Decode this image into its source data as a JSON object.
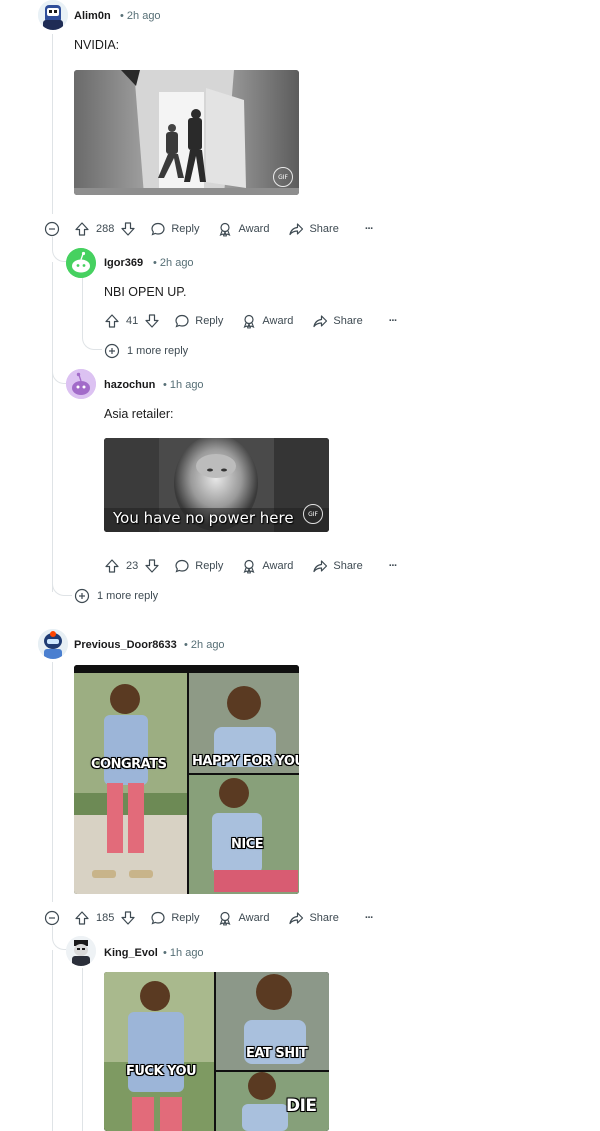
{
  "comments": [
    {
      "user": "Alim0n",
      "time": "• 2h ago",
      "text": "NVIDIA:",
      "media": {
        "type": "gif",
        "badge": "GIF"
      },
      "actions": {
        "upvotes": "288",
        "reply": "Reply",
        "award": "Award",
        "share": "Share",
        "more": "···"
      }
    },
    {
      "user": "Igor369",
      "time": "• 2h ago",
      "text": "NBI OPEN UP.",
      "actions": {
        "upvotes": "41",
        "reply": "Reply",
        "award": "Award",
        "share": "Share",
        "more": "···"
      },
      "more_replies": "1 more reply"
    },
    {
      "user": "hazochun",
      "time": "• 1h ago",
      "text": "Asia retailer:",
      "media": {
        "type": "gif",
        "badge": "GIF",
        "caption": "You have no power here"
      },
      "actions": {
        "upvotes": "23",
        "reply": "Reply",
        "award": "Award",
        "share": "Share",
        "more": "···"
      }
    },
    {
      "user": "Previous_Door8633",
      "time": "• 2h ago",
      "media": {
        "type": "image",
        "labels": [
          "CONGRATS",
          "HAPPY FOR YOU",
          "NICE"
        ]
      },
      "actions": {
        "upvotes": "185",
        "reply": "Reply",
        "award": "Award",
        "share": "Share",
        "more": "···"
      }
    },
    {
      "user": "King_Evol",
      "time": "• 1h ago",
      "media": {
        "type": "image",
        "labels": [
          "EAT SHIT",
          "FUCK YOU",
          "DIE"
        ]
      }
    }
  ],
  "thread_more_replies": "1 more reply",
  "colors": {
    "meta": "#576f76",
    "thread_line": "#dfe3e6",
    "text": "#1c1c1c"
  }
}
